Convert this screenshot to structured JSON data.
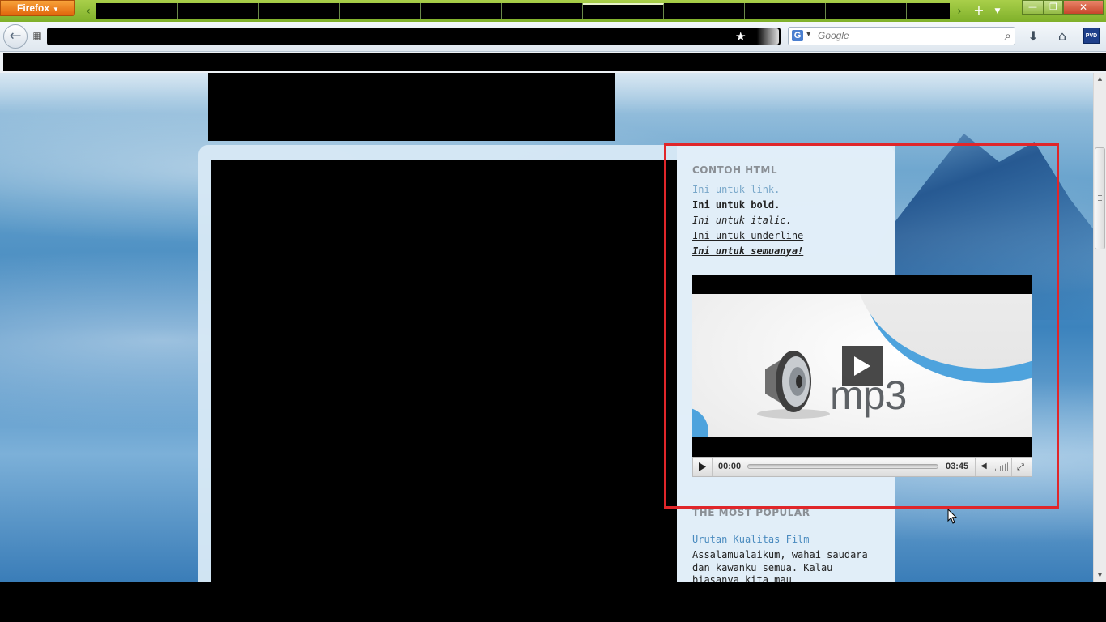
{
  "browser": {
    "menu_label": "Firefox",
    "search": {
      "engine_icon": "G",
      "placeholder": "Google"
    },
    "toolbar_icons": [
      "back-arrow-icon",
      "identity-icon",
      "bookmark-star-icon",
      "search-icon",
      "downloads-icon",
      "home-icon",
      "pvd-addon-icon"
    ],
    "addon_label": "PVD"
  },
  "sidebar": {
    "contoh": {
      "title": "CONTOH HTML",
      "link": "Ini untuk link.",
      "bold": "Ini untuk bold.",
      "italic": "Ini untuk italic.",
      "underline": "Ini untuk underline",
      "all": "Ini untuk semuanya!"
    },
    "player": {
      "poster_text": "mp3",
      "current_time": "00:00",
      "duration": "03:45",
      "progress": 0
    },
    "popular": {
      "title": "THE MOST POPULAR",
      "post_title": "Urutan Kualitas Film",
      "snippet": "Assalamualaikum, wahai saudara dan kawanku semua. Kalau biasanya kita mau"
    }
  },
  "colors": {
    "highlight_border": "#e0262a",
    "link": "#78a7c9",
    "firefox_orange": "#e0650b",
    "tabbar_green": "#8fbf35"
  }
}
